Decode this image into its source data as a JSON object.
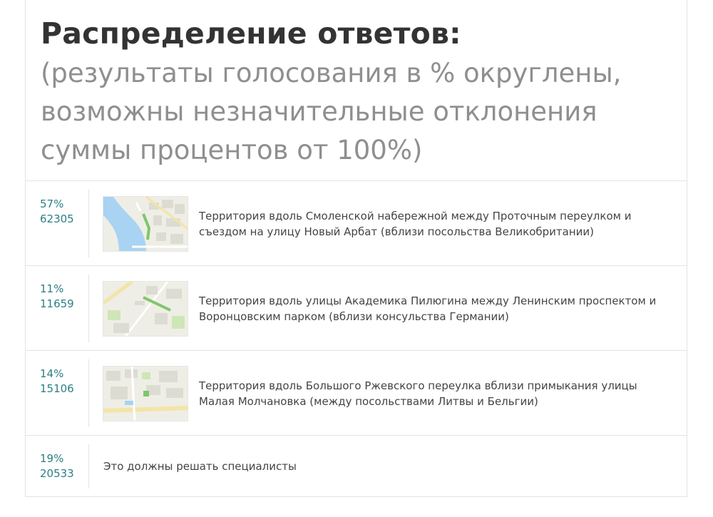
{
  "header": {
    "title": "Распределение ответов:",
    "subtitle": "(результаты голосования в % округлены, возможны незначительные отклонения суммы процентов от 100%)"
  },
  "options": [
    {
      "percent": "57%",
      "votes": "62305",
      "text": "Территория вдоль Смоленской набережной между Проточным переулком и съездом на улицу Новый Арбат (вблизи посольства Великобритании)",
      "thumbnail": "map-thumbnail"
    },
    {
      "percent": "11%",
      "votes": "11659",
      "text": "Территория вдоль улицы Академика Пилюгина между Ленинским проспектом и Воронцовским парком (вблизи консульства Германии)",
      "thumbnail": "map-thumbnail"
    },
    {
      "percent": "14%",
      "votes": "15106",
      "text": "Территория вдоль Большого Ржевского переулка вблизи примыкания улицы Малая Молчановка (между посольствами Литвы и Бельгии)",
      "thumbnail": "map-thumbnail"
    },
    {
      "percent": "19%",
      "votes": "20533",
      "text": "Это должны решать специалисты"
    }
  ],
  "colors": {
    "accent": "#2a7f86",
    "title": "#333333",
    "subtitle": "#8f8f8f",
    "map_water": "#a9d3f2",
    "map_green": "#7fc66b",
    "map_base": "#eeeee6"
  }
}
